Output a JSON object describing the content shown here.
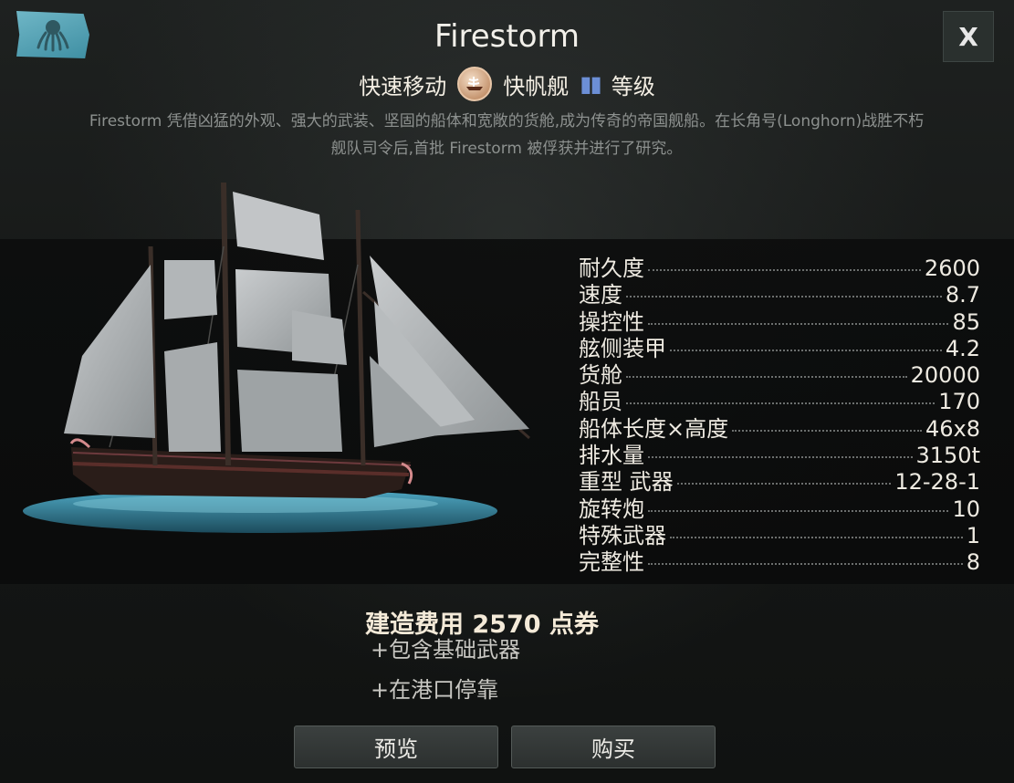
{
  "title": "Firestorm",
  "close_label": "X",
  "tags": {
    "move_label": "快速移动",
    "ship_class": "快帆舰",
    "rank_label": "等级"
  },
  "description": "Firestorm 凭借凶猛的外观、强大的武装、坚固的船体和宽敞的货舱,成为传奇的帝国舰船。在长角号(Longhorn)战胜不朽舰队司令后,首批 Firestorm 被俘获并进行了研究。",
  "stats": [
    {
      "label": "耐久度",
      "value": "2600"
    },
    {
      "label": "速度",
      "value": "8.7"
    },
    {
      "label": "操控性",
      "value": "85"
    },
    {
      "label": "舷侧装甲",
      "value": "4.2"
    },
    {
      "label": "货舱",
      "value": "20000"
    },
    {
      "label": "船员",
      "value": "170"
    },
    {
      "label": "船体长度×高度",
      "value": "46x8"
    },
    {
      "label": "排水量",
      "value": "3150t"
    },
    {
      "label": "重型  武器",
      "value": "12-28-1"
    },
    {
      "label": "旋转炮",
      "value": "10"
    },
    {
      "label": "特殊武器",
      "value": "1"
    },
    {
      "label": "完整性",
      "value": "8"
    }
  ],
  "cost": "建造费用 2570 点券",
  "includes": [
    "+包含基础武器",
    "+在港口停靠"
  ],
  "buttons": {
    "preview": "预览",
    "buy": "购买"
  },
  "colors": {
    "flag": "#5aa7b8",
    "rank_mark": "#6c8fd6",
    "panel": "#151716"
  }
}
